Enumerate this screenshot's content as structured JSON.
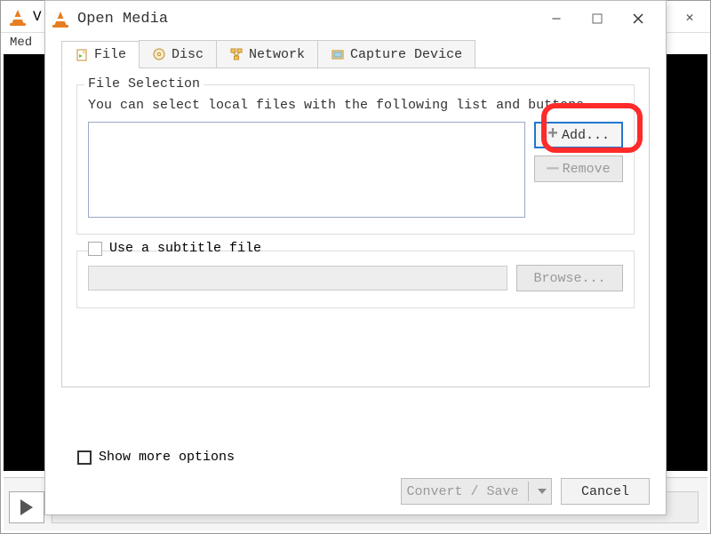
{
  "parent_window": {
    "title_fragment": "V",
    "menubar": {
      "media": "Med"
    }
  },
  "dialog": {
    "title": "Open Media",
    "window_buttons": {
      "minimize": "—",
      "maximize": "▢",
      "close": "✕"
    },
    "tabs": [
      {
        "label": "File",
        "active": true
      },
      {
        "label": "Disc",
        "active": false
      },
      {
        "label": "Network",
        "active": false
      },
      {
        "label": "Capture Device",
        "active": false
      }
    ],
    "file_tab": {
      "group_title": "File Selection",
      "hint": "You can select local files with the following list and buttons.",
      "add_label": "Add...",
      "remove_label": "Remove",
      "subtitle": {
        "checkbox_label": "Use a subtitle file",
        "browse_label": "Browse..."
      }
    },
    "show_more": {
      "label": "Show more options",
      "checked": false
    },
    "footer": {
      "convert_label": "Convert / Save",
      "cancel_label": "Cancel"
    }
  }
}
